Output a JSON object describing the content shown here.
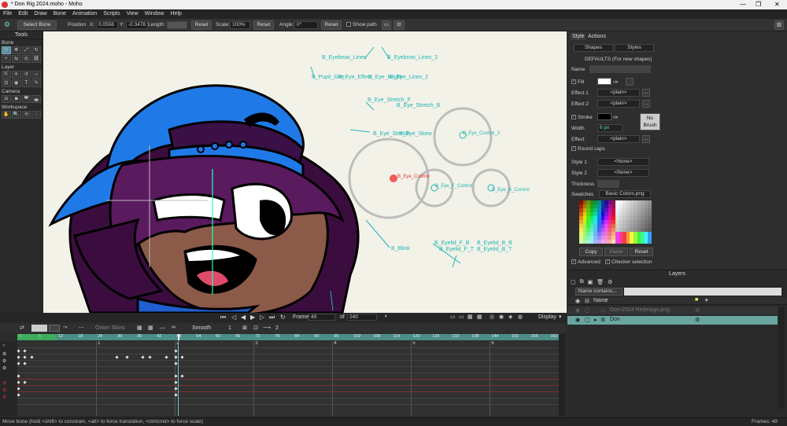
{
  "window": {
    "title": "* Don Rig 2024.moho - Moho",
    "controls": [
      "—",
      "❐",
      "✕"
    ]
  },
  "menu": [
    "File",
    "Edit",
    "Draw",
    "Bone",
    "Animation",
    "Scripts",
    "View",
    "Window",
    "Help"
  ],
  "toolbar": {
    "tool_name": "Select Bone",
    "position_label": "Position",
    "x_label": "X:",
    "x_value": "0.0556",
    "y_label": "Y:",
    "y_value": "-0.3478",
    "length_label": "Length:",
    "length_value": "",
    "reset1": "Reset",
    "scale_label": "Scale:",
    "scale_value": "100%",
    "reset2": "Reset",
    "angle_label": "Angle:",
    "angle_value": "0°",
    "reset3": "Reset",
    "show_path": "Show path"
  },
  "tools": {
    "title": "Tools",
    "sections": [
      {
        "name": "Bone",
        "rows": [
          [
            "bone-select-icon",
            "bone-translate-icon",
            "bone-scale-icon",
            "bone-rotate-icon"
          ],
          [
            "bone-add-icon",
            "bone-reparent-icon",
            "bone-strength-icon",
            "bone-bind-icon"
          ]
        ]
      },
      {
        "name": "Layer",
        "rows": [
          [
            "layer-transform-icon",
            "layer-move-icon",
            "layer-rotate-icon",
            "layer-shear-icon"
          ],
          [
            "layer-select-icon",
            "layer-eye-icon",
            "text-icon",
            "brush-icon"
          ]
        ]
      },
      {
        "name": "Camera",
        "rows": [
          [
            "camera-track-icon",
            "camera-zoom-icon",
            "camera-roll-icon",
            "camera-pan-icon"
          ]
        ]
      },
      {
        "name": "Workspace",
        "rows": [
          [
            "hand-icon",
            "zoom-icon",
            "rotate-view-icon",
            "orbit-icon"
          ]
        ]
      }
    ]
  },
  "canvas": {
    "bone_labels": [
      {
        "text": "B_Eyebrow_Lines",
        "color": "#1fb5b5"
      },
      {
        "text": "B_Eyebrow_Lines_2",
        "color": "#1fb5b5"
      },
      {
        "text": "B_Pupil_Size",
        "color": "#1fb5b5"
      },
      {
        "text": "B_Eye_Effect",
        "color": "#1fb5b5"
      },
      {
        "text": "B_Eye_Bright",
        "color": "#1fb5b5"
      },
      {
        "text": "B_Eye_Lines_2",
        "color": "#1fb5b5"
      },
      {
        "text": "B_Eye_Stretch_F",
        "color": "#1fb5b5"
      },
      {
        "text": "B_Eye_Stretch_B",
        "color": "#1fb5b5"
      },
      {
        "text": "B_Eye_Stretch",
        "color": "#1fb5b5"
      },
      {
        "text": "B_Eye_Skew",
        "color": "#1fb5b5"
      },
      {
        "text": "B_Eye_Control_2",
        "color": "#1fb5b5"
      },
      {
        "text": "B_Eye_Control",
        "color": "#e03030"
      },
      {
        "text": "B_Eye_F_Control",
        "color": "#1fb5b5"
      },
      {
        "text": "B_Eye_B_Control",
        "color": "#1fb5b5"
      },
      {
        "text": "B_Eyelid_F_B",
        "color": "#1fb5b5"
      },
      {
        "text": "B_Eyelid_B_B",
        "color": "#1fb5b5"
      },
      {
        "text": "B_Eyelid_F_T",
        "color": "#1fb5b5"
      },
      {
        "text": "B_Eyelid_B_T",
        "color": "#1fb5b5"
      },
      {
        "text": "B_Blink",
        "color": "#1fb5b5"
      }
    ]
  },
  "style_panel": {
    "tabs": [
      "Style",
      "Actions"
    ],
    "shapes": "Shapes",
    "styles": "Styles",
    "defaults_text": "DEFAULTS (For new shapes)",
    "name_label": "Name",
    "fill_label": "Fill",
    "effect1_label": "Effect 1",
    "effect1_value": "<plain>",
    "effect2_label": "Effect 2",
    "effect2_value": "<plain>",
    "stroke_label": "Stroke",
    "width_label": "Width",
    "width_value": "6 px",
    "no_brush": "No Brush",
    "effect_label": "Effect",
    "effect_value": "<plain>",
    "round_caps": "Round caps",
    "style1_label": "Style 1",
    "style1_value": "<None>",
    "style2_label": "Style 2",
    "style2_value": "<None>",
    "thickness_label": "Thickness",
    "swatches_label": "Swatches",
    "swatches_value": "Basic Colors.png",
    "copy": "Copy",
    "paste": "Paste",
    "reset": "Reset",
    "advanced": "Advanced",
    "checker": "Checker selection",
    "fill_color": "#ffffff",
    "stroke_color": "#000000"
  },
  "layers_panel": {
    "title": "Layers",
    "filter": "Name contains...",
    "header_name": "Name",
    "layers": [
      {
        "name": "Don-2024 Redesign.png",
        "selected": false
      },
      {
        "name": "Don",
        "selected": true
      }
    ]
  },
  "playback": {
    "frame_label": "Frame",
    "frame_value": "49",
    "of_label": "of",
    "total_frames": "240",
    "display": "Display"
  },
  "timeline": {
    "onion_skins": "Onion Skins",
    "smooth": "Smooth",
    "one": "1",
    "two": "2",
    "ruler_ticks": [
      "0",
      "6",
      "12",
      "18",
      "24",
      "30",
      "36",
      "42",
      "48",
      "54",
      "60",
      "66",
      "72",
      "78",
      "84",
      "90",
      "96",
      "102",
      "108",
      "114",
      "120",
      "126",
      "132",
      "138",
      "144",
      "150",
      "156",
      "162"
    ],
    "second_marks": [
      "1",
      "2",
      "3",
      "4",
      "5",
      "6"
    ]
  },
  "status": {
    "hint": "Move bone (hold <shift> to constrain, <alt> to force translation, <ctrl/cmd> to force scale)",
    "frames": "Frames: 49"
  }
}
